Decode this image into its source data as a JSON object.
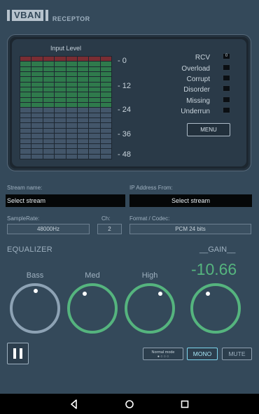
{
  "header": {
    "logo_text": "VBAN",
    "subtitle": "RECEPTOR"
  },
  "monitor": {
    "meter_title": "Input Level",
    "scale": [
      "- 0",
      "- 12",
      "- 24",
      "- 36",
      "- 48"
    ],
    "rcv_indicator": "0",
    "status": [
      "RCV",
      "Overload",
      "Corrupt",
      "Disorder",
      "Missing",
      "Underrun"
    ],
    "menu_label": "MENU"
  },
  "stream": {
    "name_label": "Stream name:",
    "name_value": "Select stream",
    "ip_label": "IP Address From:",
    "ip_value": "Select stream"
  },
  "format": {
    "samplerate_label": "SampleRate:",
    "samplerate_value": "48000Hz",
    "ch_label": "Ch:",
    "ch_value": "2",
    "codec_label": "Format / Codec:",
    "codec_value": "PCM 24 bits"
  },
  "equalizer": {
    "title": "EQUALIZER",
    "bands": [
      "Bass",
      "Med",
      "High"
    ]
  },
  "gain": {
    "title": "__GAIN__",
    "value": "-10.66"
  },
  "controls": {
    "mode_label": "Normal mode",
    "mode_dots": "● ○ ○ ○",
    "mono_label": "MONO",
    "mute_label": "MUTE"
  },
  "colors": {
    "accent_green": "#55b47e",
    "mono_accent": "#7fd7ef",
    "background": "#34495a"
  }
}
